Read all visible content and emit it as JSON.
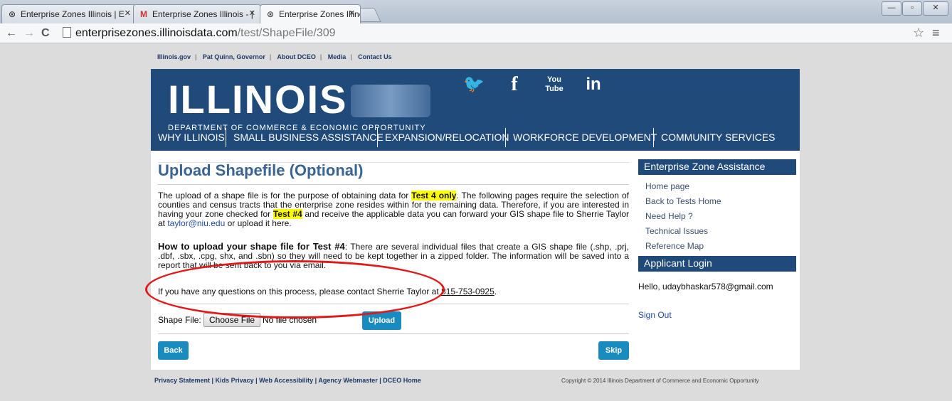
{
  "browser": {
    "tabs": [
      {
        "title": "Enterprise Zones Illinois | E",
        "icon": "seal-icon"
      },
      {
        "title": "Enterprise Zones Illinois - |",
        "icon": "gmail-icon"
      },
      {
        "title": "Enterprise Zones Illinois | S",
        "icon": "seal-icon"
      }
    ],
    "url_host": "enterprisezones.illinoisdata.com",
    "url_path": "/test/ShapeFile/309"
  },
  "header": {
    "top_links": [
      "Illinois.gov",
      "Pat Quinn, Governor",
      "About DCEO",
      "Media",
      "Contact Us"
    ],
    "brand": "ILLINOIS",
    "department": "DEPARTMENT OF COMMERCE & ECONOMIC OPPORTUNITY",
    "social": [
      "twitter-icon",
      "facebook-icon",
      "youtube-icon",
      "linkedin-icon"
    ],
    "nav": [
      "WHY ILLINOIS",
      "SMALL BUSINESS ASSISTANCE",
      "EXPANSION/RELOCATION",
      "WORKFORCE DEVELOPMENT",
      "COMMUNITY SERVICES"
    ]
  },
  "main": {
    "title": "Upload Shapefile (Optional)",
    "p1_a": "The upload of a shape file is for the purpose of obtaining data for ",
    "p1_hl1": "Test 4 only",
    "p1_b": ". The following pages require the selection of counties and census tracts that the enterprise zone resides within for the remaining data. Therefore, if you are interested in having your zone checked for ",
    "p1_hl2": "Test #4",
    "p1_c": " and receive the applicable data you can forward your GIS shape file to Sherrie Taylor at ",
    "p1_email": "taylor@niu.edu",
    "p1_d": " or upload it here.",
    "p2_bold": "How to upload your shape file for Test #4",
    "p2_rest": ": There are several individual files that create a GIS shape file (.shp, .prj, .dbf, .sbx, .cpg, shx, and .sbn) so they will need to be kept together in a zipped folder. The information will be saved into a report that will be sent back to you via email.",
    "p3_a": "If you have any questions on this process, please contact Sherrie Taylor at ",
    "p3_phone": "815-753-0925",
    "p3_b": ".",
    "shape_label": "Shape File:",
    "choose_label": "Choose File",
    "no_file": "No file chosen",
    "upload_label": "Upload",
    "back_label": "Back",
    "skip_label": "Skip"
  },
  "sidebar": {
    "assist_header": "Enterprise Zone Assistance",
    "links": [
      "Home page",
      "Back to Tests Home",
      "Need Help ?",
      "Technical Issues",
      "Reference Map"
    ],
    "login_header": "Applicant Login",
    "hello": "Hello, udaybhaskar578@gmail.com",
    "signout": "Sign Out"
  },
  "footer": {
    "links": [
      "Privacy Statement",
      "Kids Privacy",
      "Web Accessibility",
      "Agency Webmaster",
      "DCEO Home"
    ],
    "copyright": "Copyright © 2014 Illinois Department of Commerce and Economic Opportunity"
  },
  "colors": {
    "banner": "#1f4a7a",
    "button": "#1a8bbf",
    "highlight": "#ffff00",
    "annotation": "#e01a1a"
  }
}
